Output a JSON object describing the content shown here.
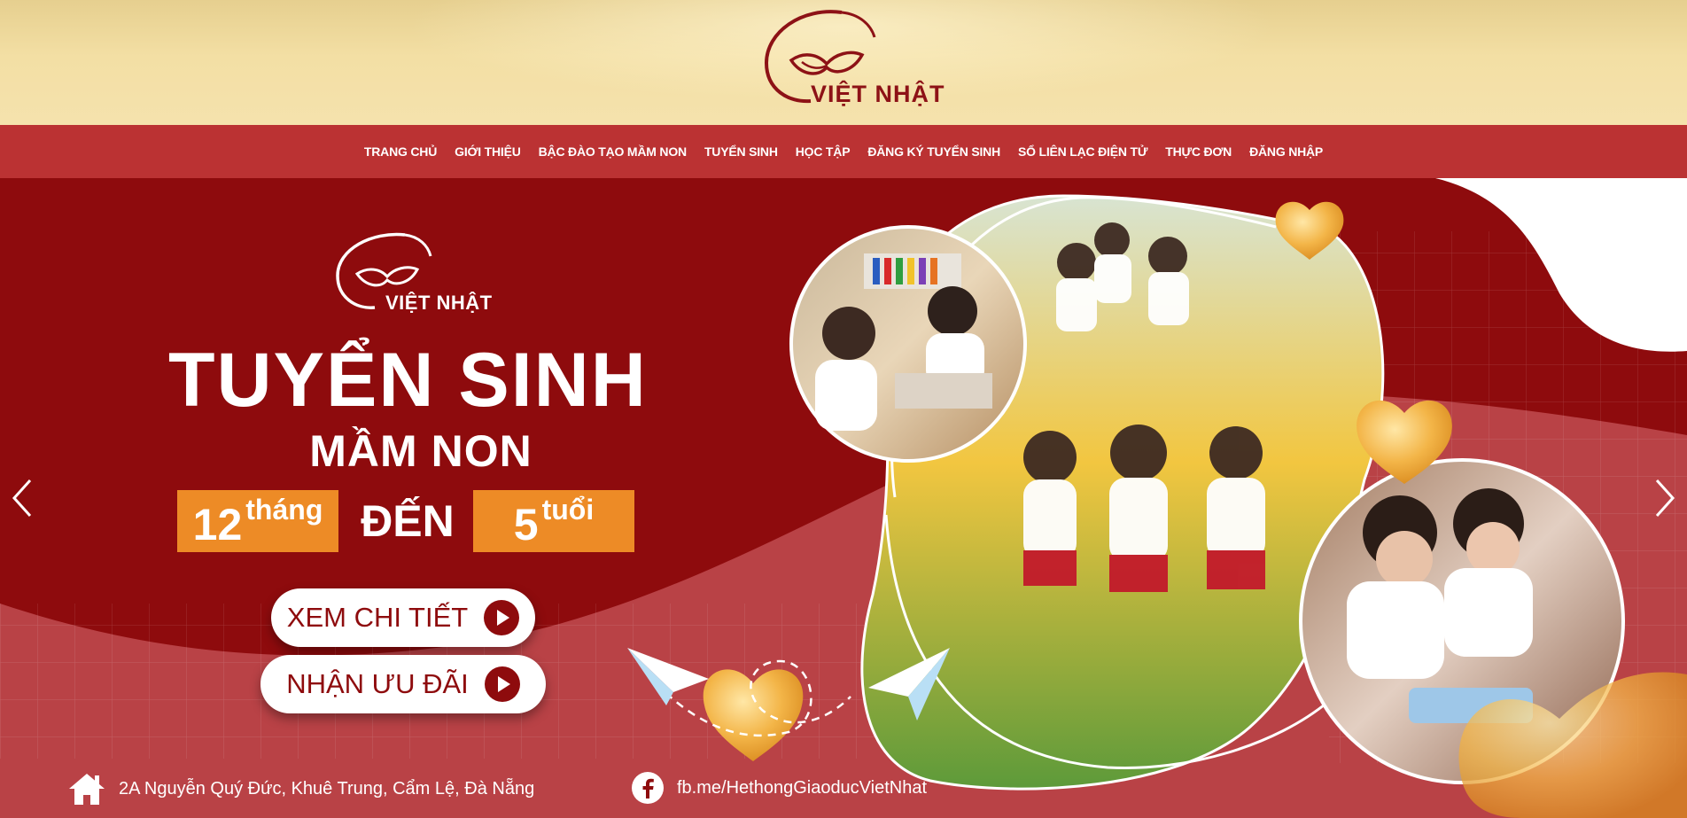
{
  "brand": {
    "name": "VIỆT NHẬT",
    "primary_color": "#8e0b0d",
    "nav_color": "#bb3233",
    "accent_orange": "#ed8b26",
    "header_gold": "#f3dfa4"
  },
  "nav": {
    "items": [
      {
        "label": "TRANG CHỦ"
      },
      {
        "label": "GIỚI THIỆU"
      },
      {
        "label": "BẬC ĐÀO TẠO MẦM NON"
      },
      {
        "label": "TUYỂN SINH"
      },
      {
        "label": "HỌC TẬP"
      },
      {
        "label": "ĐĂNG KÝ TUYỂN SINH"
      },
      {
        "label": "SỔ LIÊN LẠC ĐIỆN TỬ"
      },
      {
        "label": "THỰC ĐƠN"
      },
      {
        "label": "ĐĂNG NHẬP"
      }
    ]
  },
  "hero": {
    "title": "TUYỂN SINH",
    "subtitle": "MẦM NON",
    "age_from_num": "12",
    "age_from_unit": "tháng",
    "age_connector": "ĐẾN",
    "age_to_num": "5",
    "age_to_unit": "tuổi",
    "detail_button": "XEM CHI TIẾT",
    "offer_button": "NHẬN ƯU ĐÃI",
    "prev_icon": "chevron-left-icon",
    "next_icon": "chevron-right-icon"
  },
  "footer": {
    "address": "2A Nguyễn Quý Đức, Khuê Trung, Cẩm Lệ, Đà Nẵng",
    "facebook": "fb.me/HethongGiaoducVietNhat",
    "address_icon": "home-icon",
    "facebook_icon": "facebook-icon"
  }
}
